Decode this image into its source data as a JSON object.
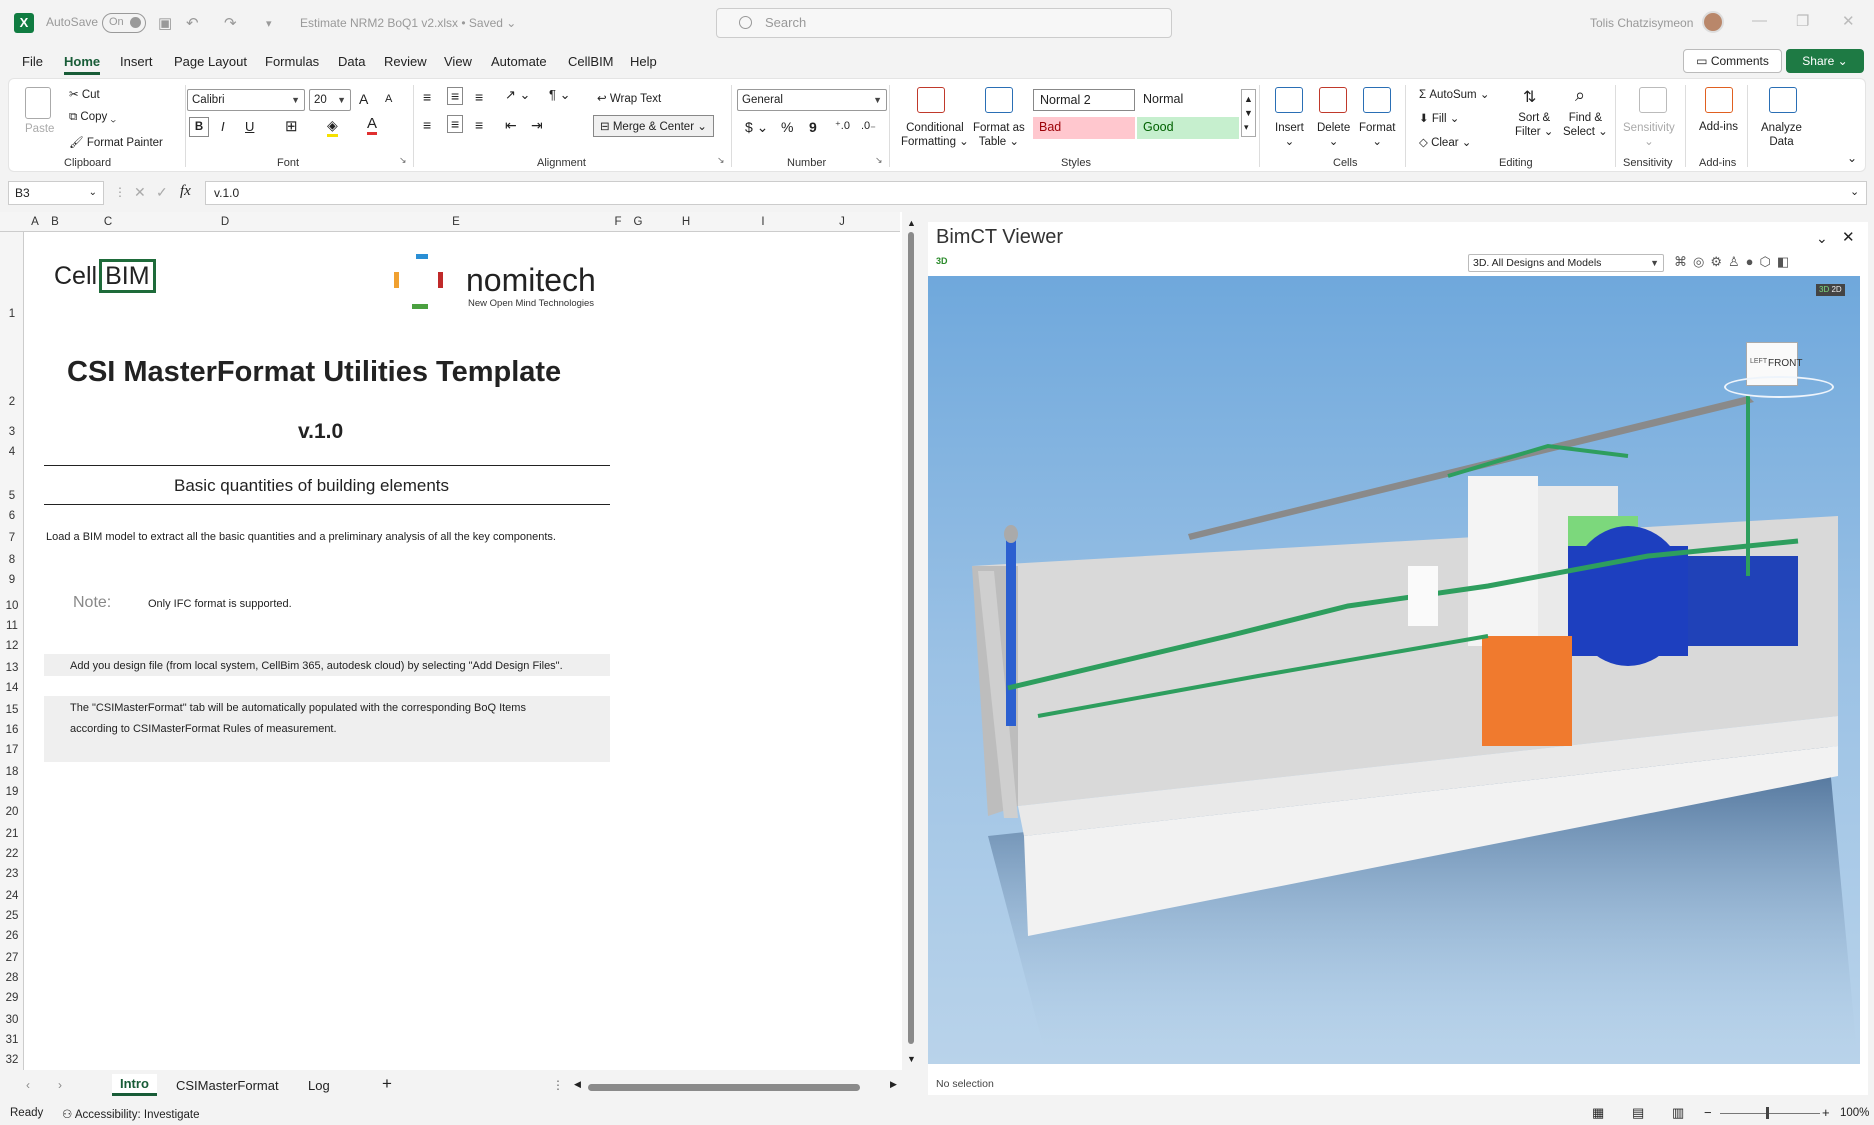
{
  "titlebar": {
    "autosave_label": "AutoSave",
    "autosave_state": "On",
    "filename": "Estimate NRM2 BoQ1 v2.xlsx",
    "saved_state": "Saved",
    "search_placeholder": "Search",
    "user_name": "Tolis Chatzisymeon"
  },
  "menu": {
    "items": [
      "File",
      "Home",
      "Insert",
      "Page Layout",
      "Formulas",
      "Data",
      "Review",
      "View",
      "Automate",
      "CellBIM",
      "Help"
    ],
    "active": "Home",
    "comments_label": "Comments",
    "share_label": "Share"
  },
  "ribbon": {
    "clipboard": {
      "paste": "Paste",
      "cut": "Cut",
      "copy": "Copy",
      "format_painter": "Format Painter",
      "label": "Clipboard"
    },
    "font": {
      "name": "Calibri",
      "size": "20",
      "bold": "B",
      "italic": "I",
      "underline": "U",
      "label": "Font",
      "grow": "A",
      "shrink": "A"
    },
    "alignment": {
      "wrap": "Wrap Text",
      "merge": "Merge & Center",
      "label": "Alignment"
    },
    "number": {
      "format": "General",
      "currency": "$",
      "percent": "%",
      "comma": "9",
      "label": "Number"
    },
    "styles": {
      "conditional": "Conditional",
      "conditional2": "Formatting",
      "format_table": "Format as",
      "format_table2": "Table",
      "normal2": "Normal 2",
      "normal": "Normal",
      "bad": "Bad",
      "good": "Good",
      "label": "Styles"
    },
    "cells": {
      "insert": "Insert",
      "delete": "Delete",
      "format": "Format",
      "label": "Cells"
    },
    "editing": {
      "autosum": "AutoSum",
      "fill": "Fill",
      "clear": "Clear",
      "sort": "Sort &",
      "sort2": "Filter",
      "find": "Find &",
      "find2": "Select",
      "label": "Editing"
    },
    "sensitivity": {
      "btn": "Sensitivity",
      "label": "Sensitivity"
    },
    "addins": {
      "btn": "Add-ins",
      "label": "Add-ins"
    },
    "analyze": {
      "btn": "Analyze",
      "btn2": "Data"
    }
  },
  "formula": {
    "cell_ref": "B3",
    "fx": "fx",
    "value": "v.1.0"
  },
  "sheet": {
    "columns": [
      "A",
      "B",
      "C",
      "D",
      "E",
      "F",
      "G",
      "H",
      "I",
      "J"
    ],
    "rows": [
      "1",
      "2",
      "3",
      "4",
      "5",
      "6",
      "7",
      "8",
      "9",
      "10",
      "11",
      "12",
      "13",
      "14",
      "15",
      "16",
      "17",
      "18",
      "19",
      "20",
      "21",
      "22",
      "23",
      "24",
      "25",
      "26",
      "27",
      "28",
      "29",
      "30",
      "31",
      "32"
    ],
    "logo_cell": "Cell",
    "logo_bim": "BIM",
    "nomitech": "nomitech",
    "nomitech_tag": "New Open Mind Technologies",
    "title": "CSI MasterFormat Utilities Template",
    "version": "v.1.0",
    "subtitle": "Basic quantities of building elements",
    "intro": "Load a BIM model to extract all the basic quantities and a preliminary analysis of all the key components.",
    "note_label": "Note:",
    "note_text": "Only IFC format is supported.",
    "step1": "Add you design file (from local system, CellBim 365, autodesk cloud) by selecting \"Add Design Files\".",
    "step2a": "The \"CSIMasterFormat\" tab will be automatically populated with the corresponding BoQ Items",
    "step2b": "according to CSIMasterFormat Rules of measurement."
  },
  "tabs": {
    "items": [
      "Intro",
      "CSIMasterFormat",
      "Log"
    ],
    "active": "Intro",
    "add": "+"
  },
  "viewer": {
    "title": "BimCT Viewer",
    "mode": "3D",
    "dropdown": "3D. All Designs and Models",
    "toggle_3d": "3D",
    "toggle_2d": "2D",
    "cube_front": "FRONT",
    "cube_left": "LEFT",
    "selection": "No selection"
  },
  "status": {
    "ready": "Ready",
    "accessibility": "Accessibility: Investigate",
    "zoom": "100%"
  },
  "colors": {
    "excel_green": "#107c41",
    "share_green": "#1e7a44",
    "sky": "#7aaee0",
    "pipe": "#2e9e5e",
    "tank_blue": "#1d3fbf",
    "box_orange": "#f07a2e"
  }
}
